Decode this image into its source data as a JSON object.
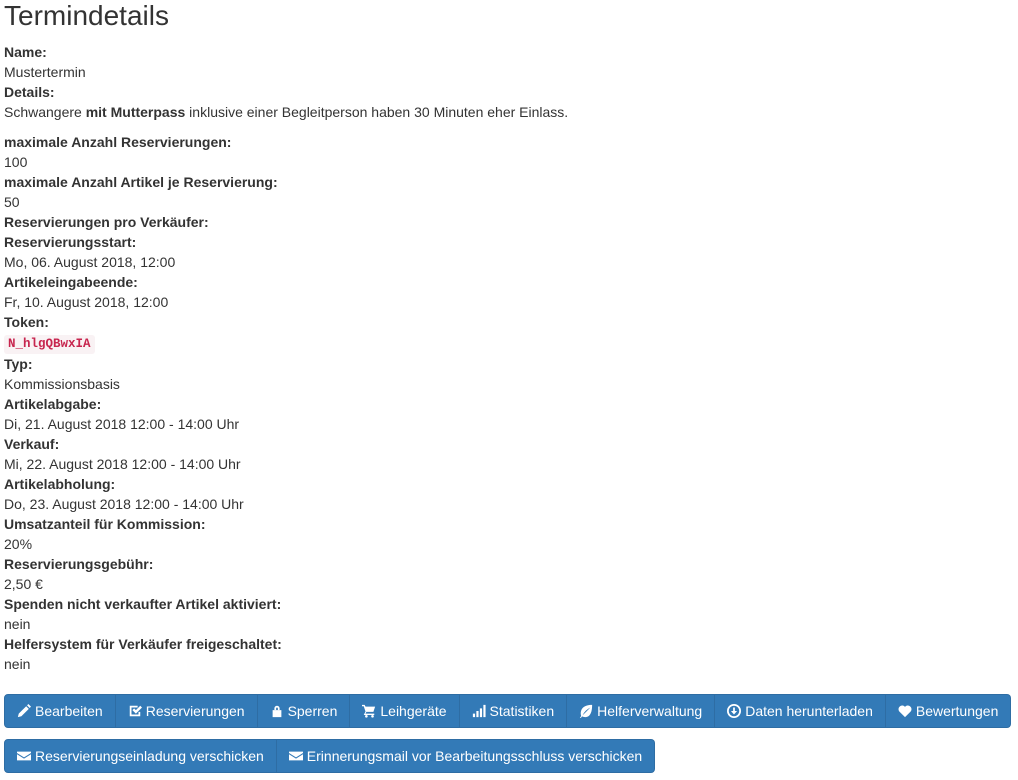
{
  "page_title": "Termindetails",
  "fields": {
    "name_label": "Name:",
    "name_value": "Mustertermin",
    "details_label": "Details:",
    "details_pre": "Schwangere ",
    "details_bold": "mit Mutterpass",
    "details_post": " inklusive einer Begleitperson haben 30 Minuten eher Einlass.",
    "max_res_label": "maximale Anzahl Reservierungen:",
    "max_res_value": "100",
    "max_items_label": "maximale Anzahl Artikel je Reservierung:",
    "max_items_value": "50",
    "res_per_seller_label": "Reservierungen pro Verkäufer:",
    "res_start_label": "Reservierungsstart:",
    "res_start_value": "Mo, 06. August 2018, 12:00",
    "item_entry_end_label": "Artikeleingabeende:",
    "item_entry_end_value": "Fr, 10. August 2018, 12:00",
    "token_label": "Token:",
    "token_value": "N_hlgQBwxIA",
    "type_label": "Typ:",
    "type_value": "Kommissionsbasis",
    "drop_off_label": "Artikelabgabe:",
    "drop_off_value": "Di, 21. August 2018 12:00 - 14:00 Uhr",
    "sale_label": "Verkauf:",
    "sale_value": "Mi, 22. August 2018 12:00 - 14:00 Uhr",
    "pickup_label": "Artikelabholung:",
    "pickup_value": "Do, 23. August 2018 12:00 - 14:00 Uhr",
    "commission_label": "Umsatzanteil für Kommission:",
    "commission_value": "20%",
    "fee_label": "Reservierungsgebühr:",
    "fee_value": "2,50 €",
    "donation_label": "Spenden nicht verkaufter Artikel aktiviert:",
    "donation_value": "nein",
    "helper_label": "Helfersystem für Verkäufer freigeschaltet:",
    "helper_value": "nein"
  },
  "toolbar": {
    "edit": "Bearbeiten",
    "reservations": "Reservierungen",
    "lock": "Sperren",
    "rental": "Leihgeräte",
    "stats": "Statistiken",
    "helpers": "Helferverwaltung",
    "download": "Daten herunterladen",
    "ratings": "Bewertungen",
    "invite": "Reservierungseinladung verschicken",
    "reminder": "Erinnerungsmail vor Bearbeitungsschluss verschicken"
  },
  "icons": {
    "edit": "pencil-icon",
    "reservations": "check-square-icon",
    "lock": "lock-icon",
    "rental": "cart-icon",
    "stats": "bar-chart-icon",
    "helpers": "leaf-icon",
    "download": "download-circle-icon",
    "ratings": "heart-icon",
    "invite": "envelope-icon",
    "reminder": "envelope-icon"
  },
  "colors": {
    "button_bg": "#337ab7",
    "button_border": "#2e6da4",
    "token_fg": "#c7254e",
    "token_bg": "#f9f2f4"
  }
}
